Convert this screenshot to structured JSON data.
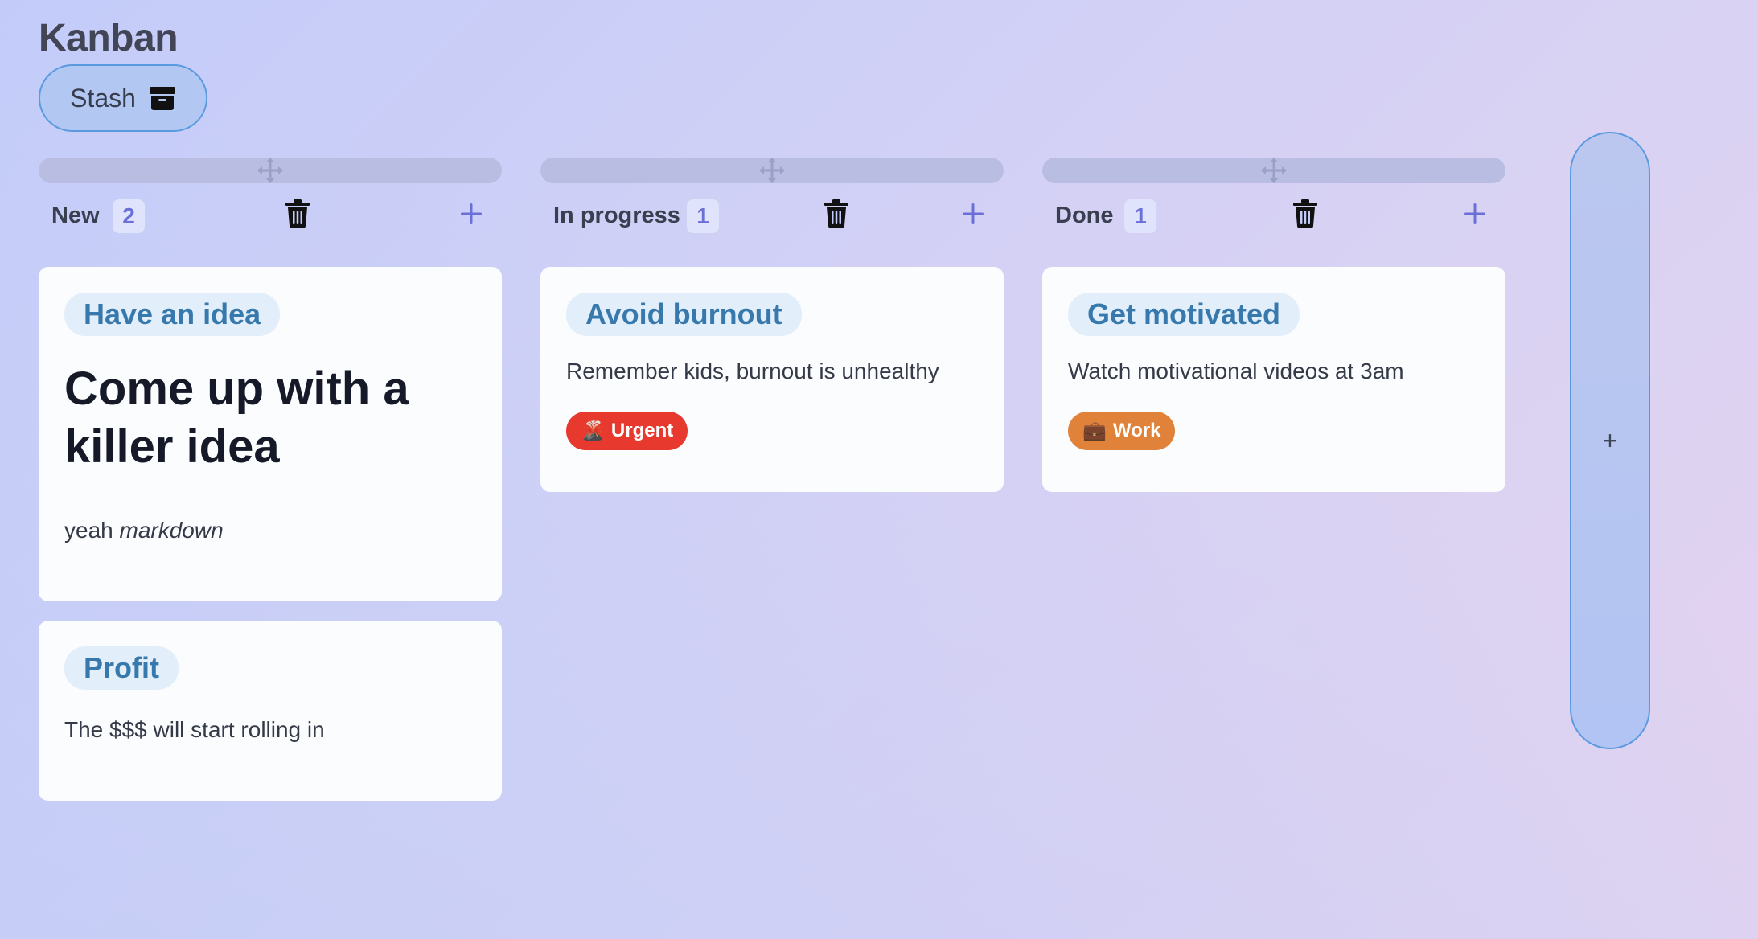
{
  "app": {
    "title": "Kanban",
    "stash_label": "Stash"
  },
  "columns": [
    {
      "name": "New",
      "count": "2",
      "cards": [
        {
          "title": "Have an idea",
          "heading": "Come up with a killer idea",
          "text_plain": "yeah ",
          "text_em": "markdown"
        },
        {
          "title": "Profit",
          "text": "The $$$ will start rolling in"
        }
      ]
    },
    {
      "name": "In progress",
      "count": "1",
      "cards": [
        {
          "title": "Avoid burnout",
          "text": "Remember kids, burnout is unhealthy",
          "tag": {
            "emoji": "🌋",
            "label": "Urgent",
            "color": "#e8392f"
          }
        }
      ]
    },
    {
      "name": "Done",
      "count": "1",
      "cards": [
        {
          "title": "Get motivated",
          "text": "Watch motivational videos at 3am",
          "tag": {
            "emoji": "💼",
            "label": "Work",
            "color": "#e0823a"
          }
        }
      ]
    }
  ],
  "add_column_label": "+",
  "colors": {
    "accent": "#6b70d9",
    "card_title_bg": "#e2eefa",
    "card_title_text": "#3779ac",
    "stash_border": "#5c9ae0"
  }
}
